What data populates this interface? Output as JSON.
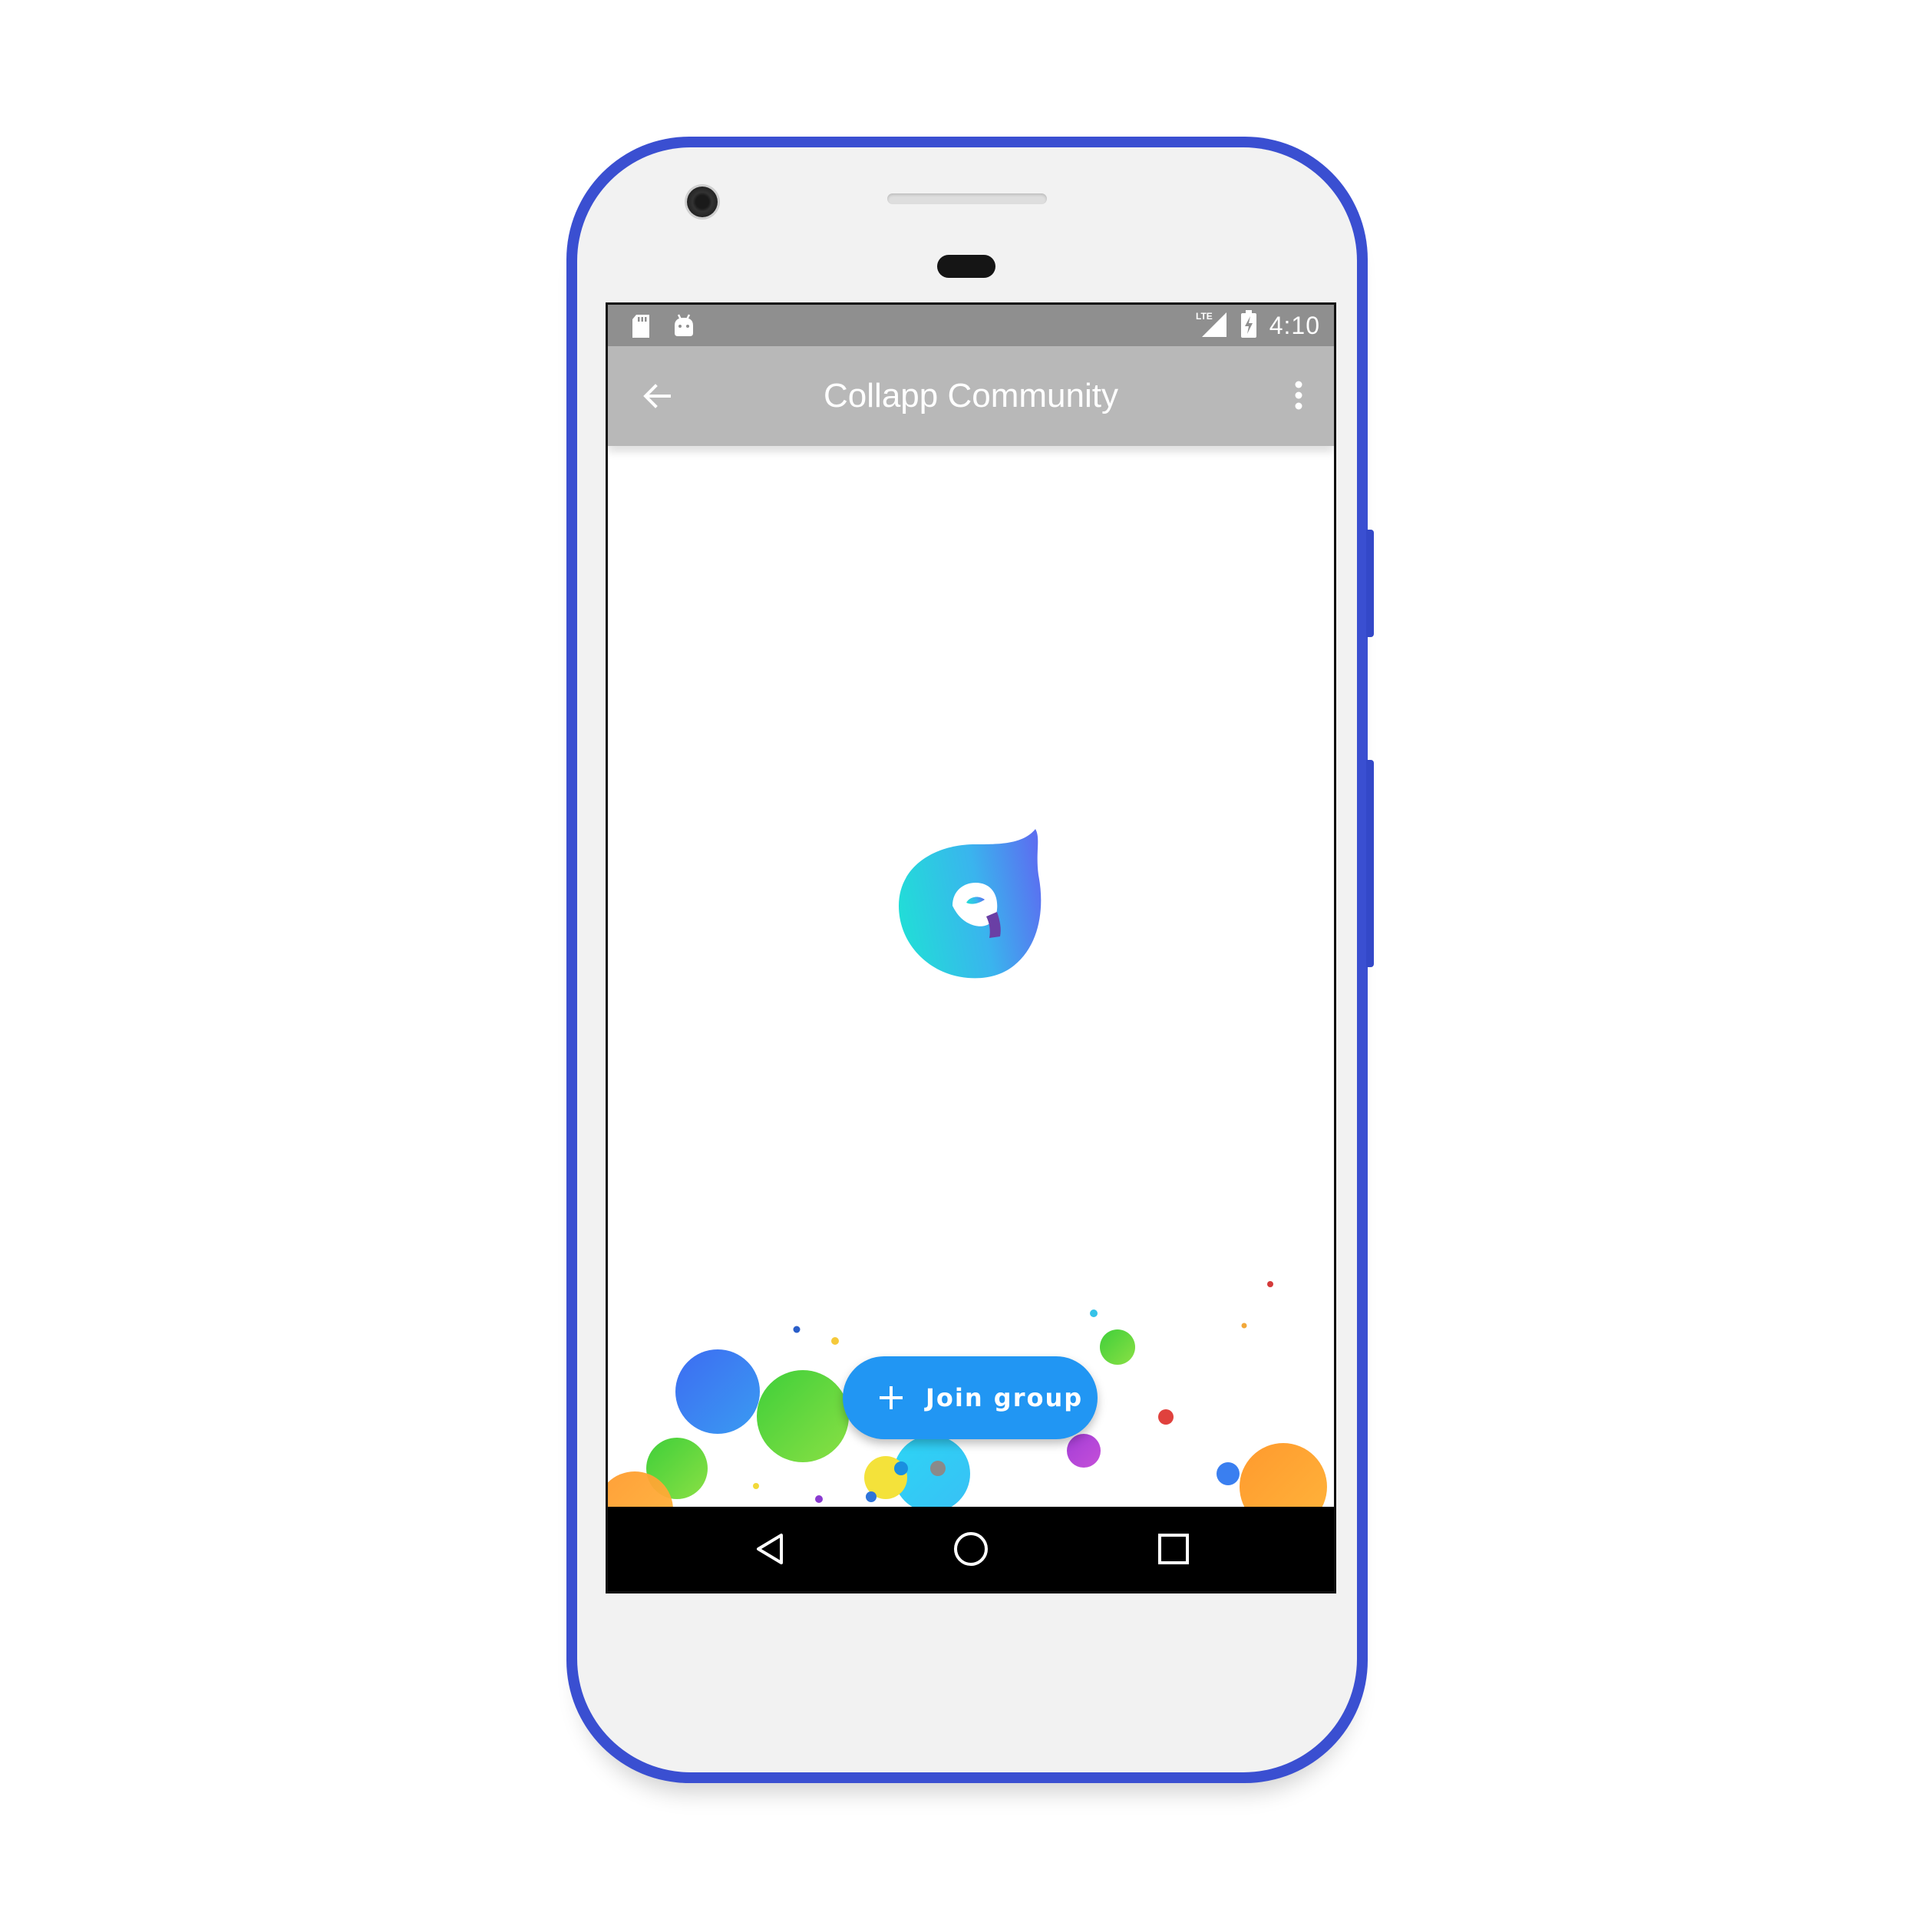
{
  "status_bar": {
    "time": "4:10",
    "icons": [
      "sd-card-icon",
      "android-icon",
      "lte-signal-icon",
      "battery-charging-icon"
    ],
    "network_label": "LTE"
  },
  "app_bar": {
    "title": "Collapp Community",
    "back_icon": "arrow-back-icon",
    "menu_icon": "more-vert-icon"
  },
  "fab": {
    "label": "Join group",
    "icon": "plus-icon",
    "color": "#2196f3"
  },
  "nav_bar": {
    "icons": [
      "back-triangle-icon",
      "home-circle-icon",
      "recents-square-icon"
    ]
  },
  "colors": {
    "phone_frame": "#3a4fd1",
    "status_bar": "#8f8f8f",
    "app_bar": "#b8b8b8",
    "accent": "#2196f3"
  }
}
